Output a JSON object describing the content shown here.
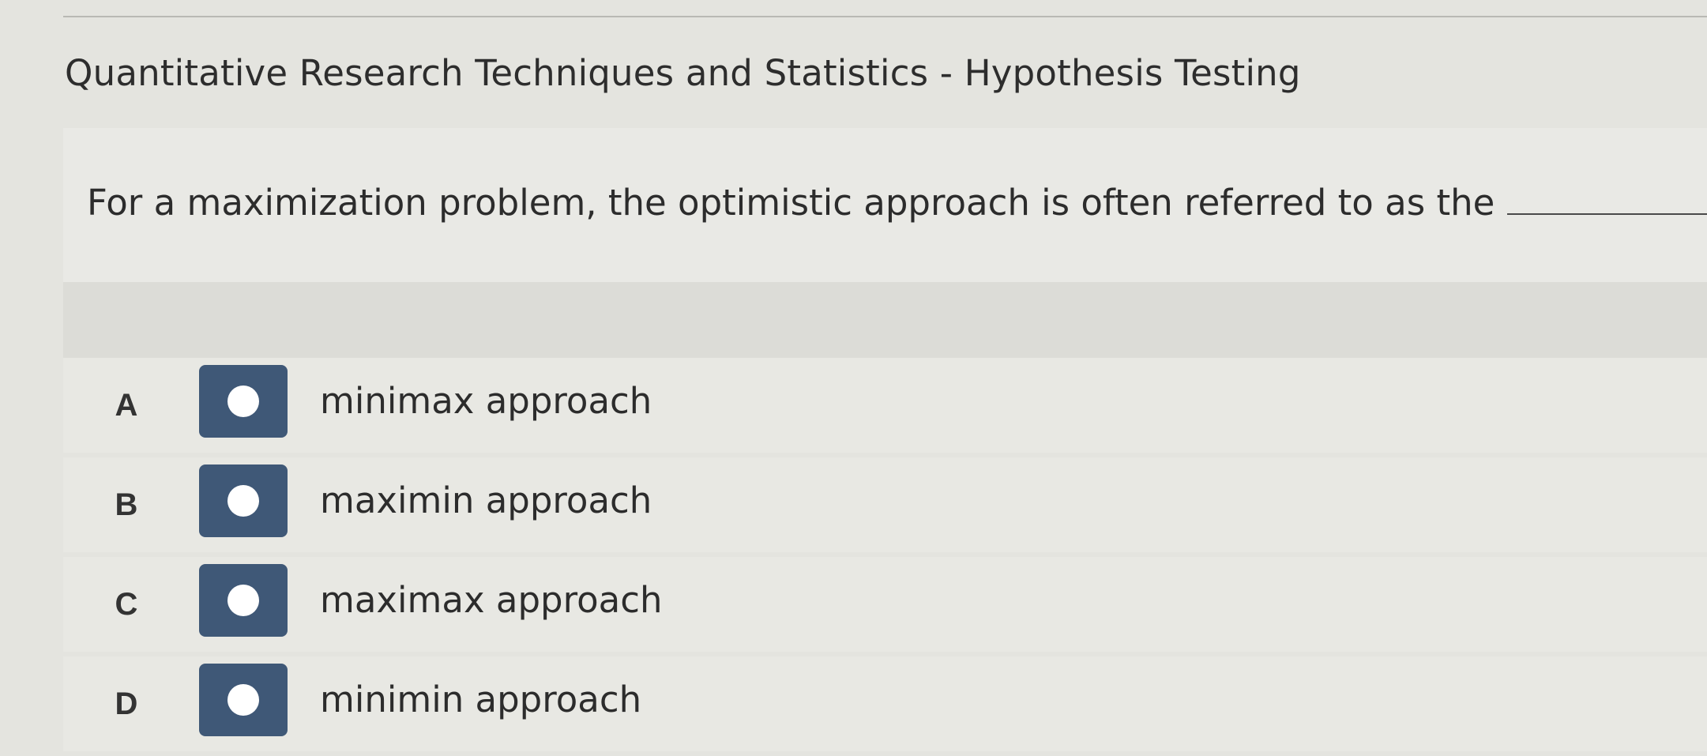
{
  "header": {
    "title": "Quantitative Research Techniques and Statistics - Hypothesis Testing"
  },
  "question": {
    "prompt": "For a maximization problem, the optimistic approach is often referred to as the",
    "terminal_punctuation": "."
  },
  "options": [
    {
      "letter": "A",
      "text": "minimax approach"
    },
    {
      "letter": "B",
      "text": "maximin approach"
    },
    {
      "letter": "C",
      "text": "maximax approach"
    },
    {
      "letter": "D",
      "text": "minimin approach"
    }
  ],
  "colors": {
    "radio_button": "#3f5877",
    "background": "#e4e4df"
  }
}
